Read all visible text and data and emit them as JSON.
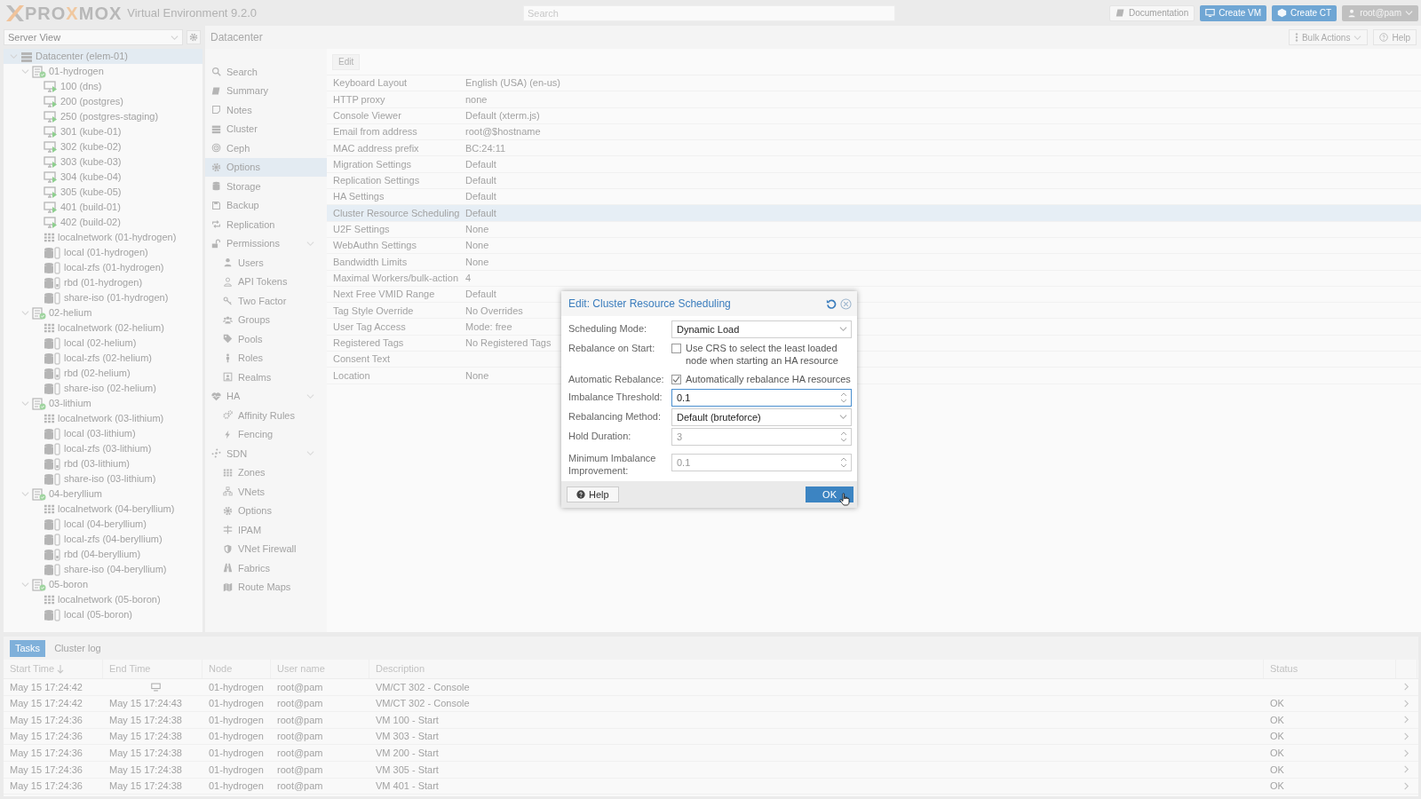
{
  "header": {
    "logo_text": "PROXMOX",
    "product": "Virtual Environment 9.2.0",
    "search": {
      "placeholder": "Search"
    },
    "buttons": [
      {
        "label": "Documentation",
        "kind": "docs"
      },
      {
        "label": "Create VM",
        "kind": "create-vm"
      },
      {
        "label": "Create CT",
        "kind": "create-ct"
      },
      {
        "label": "root@pam",
        "kind": "user"
      }
    ]
  },
  "view_selector": {
    "value": "Server View"
  },
  "resource_tree": [
    {
      "label": "Datacenter (elem-01)",
      "kind": "datacenter",
      "selected": true,
      "expanded": true,
      "children": [
        {
          "label": "01-hydrogen",
          "kind": "node",
          "selected": false,
          "expanded": true,
          "children": [
            {
              "label": "100 (dns)",
              "kind": "vm",
              "selected": false
            },
            {
              "label": "200 (postgres)",
              "kind": "vm",
              "selected": false
            },
            {
              "label": "250 (postgres-staging)",
              "kind": "vm",
              "selected": false
            },
            {
              "label": "301 (kube-01)",
              "kind": "vm",
              "selected": false
            },
            {
              "label": "302 (kube-02)",
              "kind": "vm",
              "selected": false
            },
            {
              "label": "303 (kube-03)",
              "kind": "vm",
              "selected": false
            },
            {
              "label": "304 (kube-04)",
              "kind": "vm",
              "selected": false
            },
            {
              "label": "305 (kube-05)",
              "kind": "vm",
              "selected": false
            },
            {
              "label": "401 (build-01)",
              "kind": "vm",
              "selected": false
            },
            {
              "label": "402 (build-02)",
              "kind": "vm",
              "selected": false
            },
            {
              "label": "localnetwork (01-hydrogen)",
              "kind": "sdn",
              "selected": false
            },
            {
              "label": "local (01-hydrogen)",
              "kind": "storage",
              "selected": false
            },
            {
              "label": "local-zfs (01-hydrogen)",
              "kind": "storage",
              "selected": false
            },
            {
              "label": "rbd (01-hydrogen)",
              "kind": "rbd",
              "selected": false
            },
            {
              "label": "share-iso (01-hydrogen)",
              "kind": "storage",
              "selected": false
            }
          ]
        },
        {
          "label": "02-helium",
          "kind": "node",
          "selected": false,
          "expanded": true,
          "children": [
            {
              "label": "localnetwork (02-helium)",
              "kind": "sdn",
              "selected": false
            },
            {
              "label": "local (02-helium)",
              "kind": "storage",
              "selected": false
            },
            {
              "label": "local-zfs (02-helium)",
              "kind": "storage",
              "selected": false
            },
            {
              "label": "rbd (02-helium)",
              "kind": "rbd",
              "selected": false
            },
            {
              "label": "share-iso (02-helium)",
              "kind": "storage",
              "selected": false
            }
          ]
        },
        {
          "label": "03-lithium",
          "kind": "node",
          "selected": false,
          "expanded": true,
          "children": [
            {
              "label": "localnetwork (03-lithium)",
              "kind": "sdn",
              "selected": false
            },
            {
              "label": "local (03-lithium)",
              "kind": "storage",
              "selected": false
            },
            {
              "label": "local-zfs (03-lithium)",
              "kind": "storage",
              "selected": false
            },
            {
              "label": "rbd (03-lithium)",
              "kind": "rbd",
              "selected": false
            },
            {
              "label": "share-iso (03-lithium)",
              "kind": "storage",
              "selected": false
            }
          ]
        },
        {
          "label": "04-beryllium",
          "kind": "node",
          "selected": false,
          "expanded": true,
          "children": [
            {
              "label": "localnetwork (04-beryllium)",
              "kind": "sdn",
              "selected": false
            },
            {
              "label": "local (04-beryllium)",
              "kind": "storage",
              "selected": false
            },
            {
              "label": "local-zfs (04-beryllium)",
              "kind": "storage",
              "selected": false
            },
            {
              "label": "rbd (04-beryllium)",
              "kind": "rbd",
              "selected": false
            },
            {
              "label": "share-iso (04-beryllium)",
              "kind": "storage",
              "selected": false
            }
          ]
        },
        {
          "label": "05-boron",
          "kind": "node",
          "selected": false,
          "expanded": true,
          "children": [
            {
              "label": "localnetwork (05-boron)",
              "kind": "sdn",
              "selected": false
            },
            {
              "label": "local (05-boron)",
              "kind": "storage",
              "selected": false
            }
          ]
        }
      ]
    }
  ],
  "content_header": {
    "title": "Datacenter",
    "buttons": [
      {
        "label": "Bulk Actions",
        "kind": "menu"
      },
      {
        "label": "Help",
        "kind": "help"
      }
    ]
  },
  "nav": [
    {
      "label": "Search",
      "selected": false
    },
    {
      "label": "Summary",
      "selected": false
    },
    {
      "label": "Notes",
      "selected": false
    },
    {
      "label": "Cluster",
      "selected": false
    },
    {
      "label": "Ceph",
      "selected": false
    },
    {
      "label": "Options",
      "selected": true
    },
    {
      "label": "Storage",
      "selected": false
    },
    {
      "label": "Backup",
      "selected": false
    },
    {
      "label": "Replication",
      "selected": false
    },
    {
      "label": "Permissions",
      "selected": false,
      "expanded": true,
      "children": [
        {
          "label": "Users",
          "selected": false
        },
        {
          "label": "API Tokens",
          "selected": false
        },
        {
          "label": "Two Factor",
          "selected": false
        },
        {
          "label": "Groups",
          "selected": false
        },
        {
          "label": "Pools",
          "selected": false
        },
        {
          "label": "Roles",
          "selected": false
        },
        {
          "label": "Realms",
          "selected": false
        }
      ]
    },
    {
      "label": "HA",
      "selected": false,
      "expanded": true,
      "children": [
        {
          "label": "Affinity Rules",
          "selected": false
        },
        {
          "label": "Fencing",
          "selected": false
        }
      ]
    },
    {
      "label": "SDN",
      "selected": false,
      "expanded": true,
      "children": [
        {
          "label": "Zones",
          "selected": false
        },
        {
          "label": "VNets",
          "selected": false
        },
        {
          "label": "Options",
          "selected": false
        },
        {
          "label": "IPAM",
          "selected": false
        },
        {
          "label": "VNet Firewall",
          "selected": false
        },
        {
          "label": "Fabrics",
          "selected": false
        },
        {
          "label": "Route Maps",
          "selected": false
        }
      ]
    }
  ],
  "options": {
    "toolbar": [
      "Edit"
    ],
    "rows": [
      {
        "name": "Keyboard Layout",
        "value": "English (USA) (en-us)",
        "selected": false
      },
      {
        "name": "HTTP proxy",
        "value": "none",
        "selected": false
      },
      {
        "name": "Console Viewer",
        "value": "Default (xterm.js)",
        "selected": false
      },
      {
        "name": "Email from address",
        "value": "root@$hostname",
        "selected": false
      },
      {
        "name": "MAC address prefix",
        "value": "BC:24:11",
        "selected": false
      },
      {
        "name": "Migration Settings",
        "value": "Default",
        "selected": false
      },
      {
        "name": "Replication Settings",
        "value": "Default",
        "selected": false
      },
      {
        "name": "HA Settings",
        "value": "Default",
        "selected": false
      },
      {
        "name": "Cluster Resource Scheduling",
        "value": "Default",
        "selected": true
      },
      {
        "name": "U2F Settings",
        "value": "None",
        "selected": false
      },
      {
        "name": "WebAuthn Settings",
        "value": "None",
        "selected": false
      },
      {
        "name": "Bandwidth Limits",
        "value": "None",
        "selected": false
      },
      {
        "name": "Maximal Workers/bulk-action",
        "value": "4",
        "selected": false
      },
      {
        "name": "Next Free VMID Range",
        "value": "Default",
        "selected": false
      },
      {
        "name": "Tag Style Override",
        "value": "No Overrides",
        "selected": false
      },
      {
        "name": "User Tag Access",
        "value": "Mode: free",
        "selected": false
      },
      {
        "name": "Registered Tags",
        "value": "No Registered Tags",
        "selected": false
      },
      {
        "name": "Consent Text",
        "selected": false
      },
      {
        "name": "Location",
        "value": "None",
        "selected": false
      }
    ]
  },
  "dialog": {
    "title": "Edit: Cluster Resource Scheduling",
    "fields": [
      {
        "kind": "combo",
        "label": "Scheduling Mode:",
        "value": "Dynamic Load",
        "focused": false
      },
      {
        "kind": "checkbox",
        "label": "Rebalance on Start:",
        "text": "Use CRS to select the least loaded node when starting an HA resource",
        "checked": false
      },
      {
        "kind": "checkbox",
        "label": "Automatic Rebalance:",
        "text": "Automatically rebalance HA resources",
        "checked": true
      },
      {
        "kind": "number",
        "label": "Imbalance Threshold:",
        "value": "0.1",
        "focused": true
      },
      {
        "kind": "combo",
        "label": "Rebalancing Method:",
        "value": "Default (bruteforce)",
        "focused": false
      },
      {
        "kind": "number",
        "label": "Hold Duration:",
        "placeholder": "3",
        "focused": false
      },
      {
        "kind": "number",
        "label": "Minimum Imbalance Improvement:",
        "placeholder": "0.1",
        "focused": false
      }
    ],
    "buttons": [
      {
        "label": "Help",
        "kind": "help"
      },
      {
        "label": "OK",
        "kind": "primary"
      }
    ]
  },
  "tasks": {
    "tabs": [
      {
        "label": "Tasks",
        "selected": true
      },
      {
        "label": "Cluster log",
        "selected": false
      }
    ],
    "columns": [
      {
        "label": "Start Time",
        "sorted": true
      },
      {
        "label": "End Time",
        "sorted": false
      },
      {
        "label": "Node",
        "sorted": false
      },
      {
        "label": "User name",
        "sorted": false
      },
      {
        "label": "Description",
        "sorted": false
      },
      {
        "label": "Status",
        "sorted": false
      }
    ],
    "rows": [
      {
        "start": "May 15 17:24:42",
        "running": true,
        "node": "01-hydrogen",
        "user": "root@pam",
        "description": "VM/CT 302 - Console"
      },
      {
        "start": "May 15 17:24:42",
        "end": "May 15 17:24:43",
        "running": false,
        "node": "01-hydrogen",
        "user": "root@pam",
        "description": "VM/CT 302 - Console",
        "status": "OK"
      },
      {
        "start": "May 15 17:24:36",
        "end": "May 15 17:24:38",
        "running": false,
        "node": "01-hydrogen",
        "user": "root@pam",
        "description": "VM 100 - Start",
        "status": "OK"
      },
      {
        "start": "May 15 17:24:36",
        "end": "May 15 17:24:38",
        "running": false,
        "node": "01-hydrogen",
        "user": "root@pam",
        "description": "VM 303 - Start",
        "status": "OK"
      },
      {
        "start": "May 15 17:24:36",
        "end": "May 15 17:24:38",
        "running": false,
        "node": "01-hydrogen",
        "user": "root@pam",
        "description": "VM 200 - Start",
        "status": "OK"
      },
      {
        "start": "May 15 17:24:36",
        "end": "May 15 17:24:38",
        "running": false,
        "node": "01-hydrogen",
        "user": "root@pam",
        "description": "VM 305 - Start",
        "status": "OK"
      },
      {
        "start": "May 15 17:24:36",
        "end": "May 15 17:24:38",
        "running": false,
        "node": "01-hydrogen",
        "user": "root@pam",
        "description": "VM 401 - Start",
        "status": "OK"
      }
    ]
  }
}
